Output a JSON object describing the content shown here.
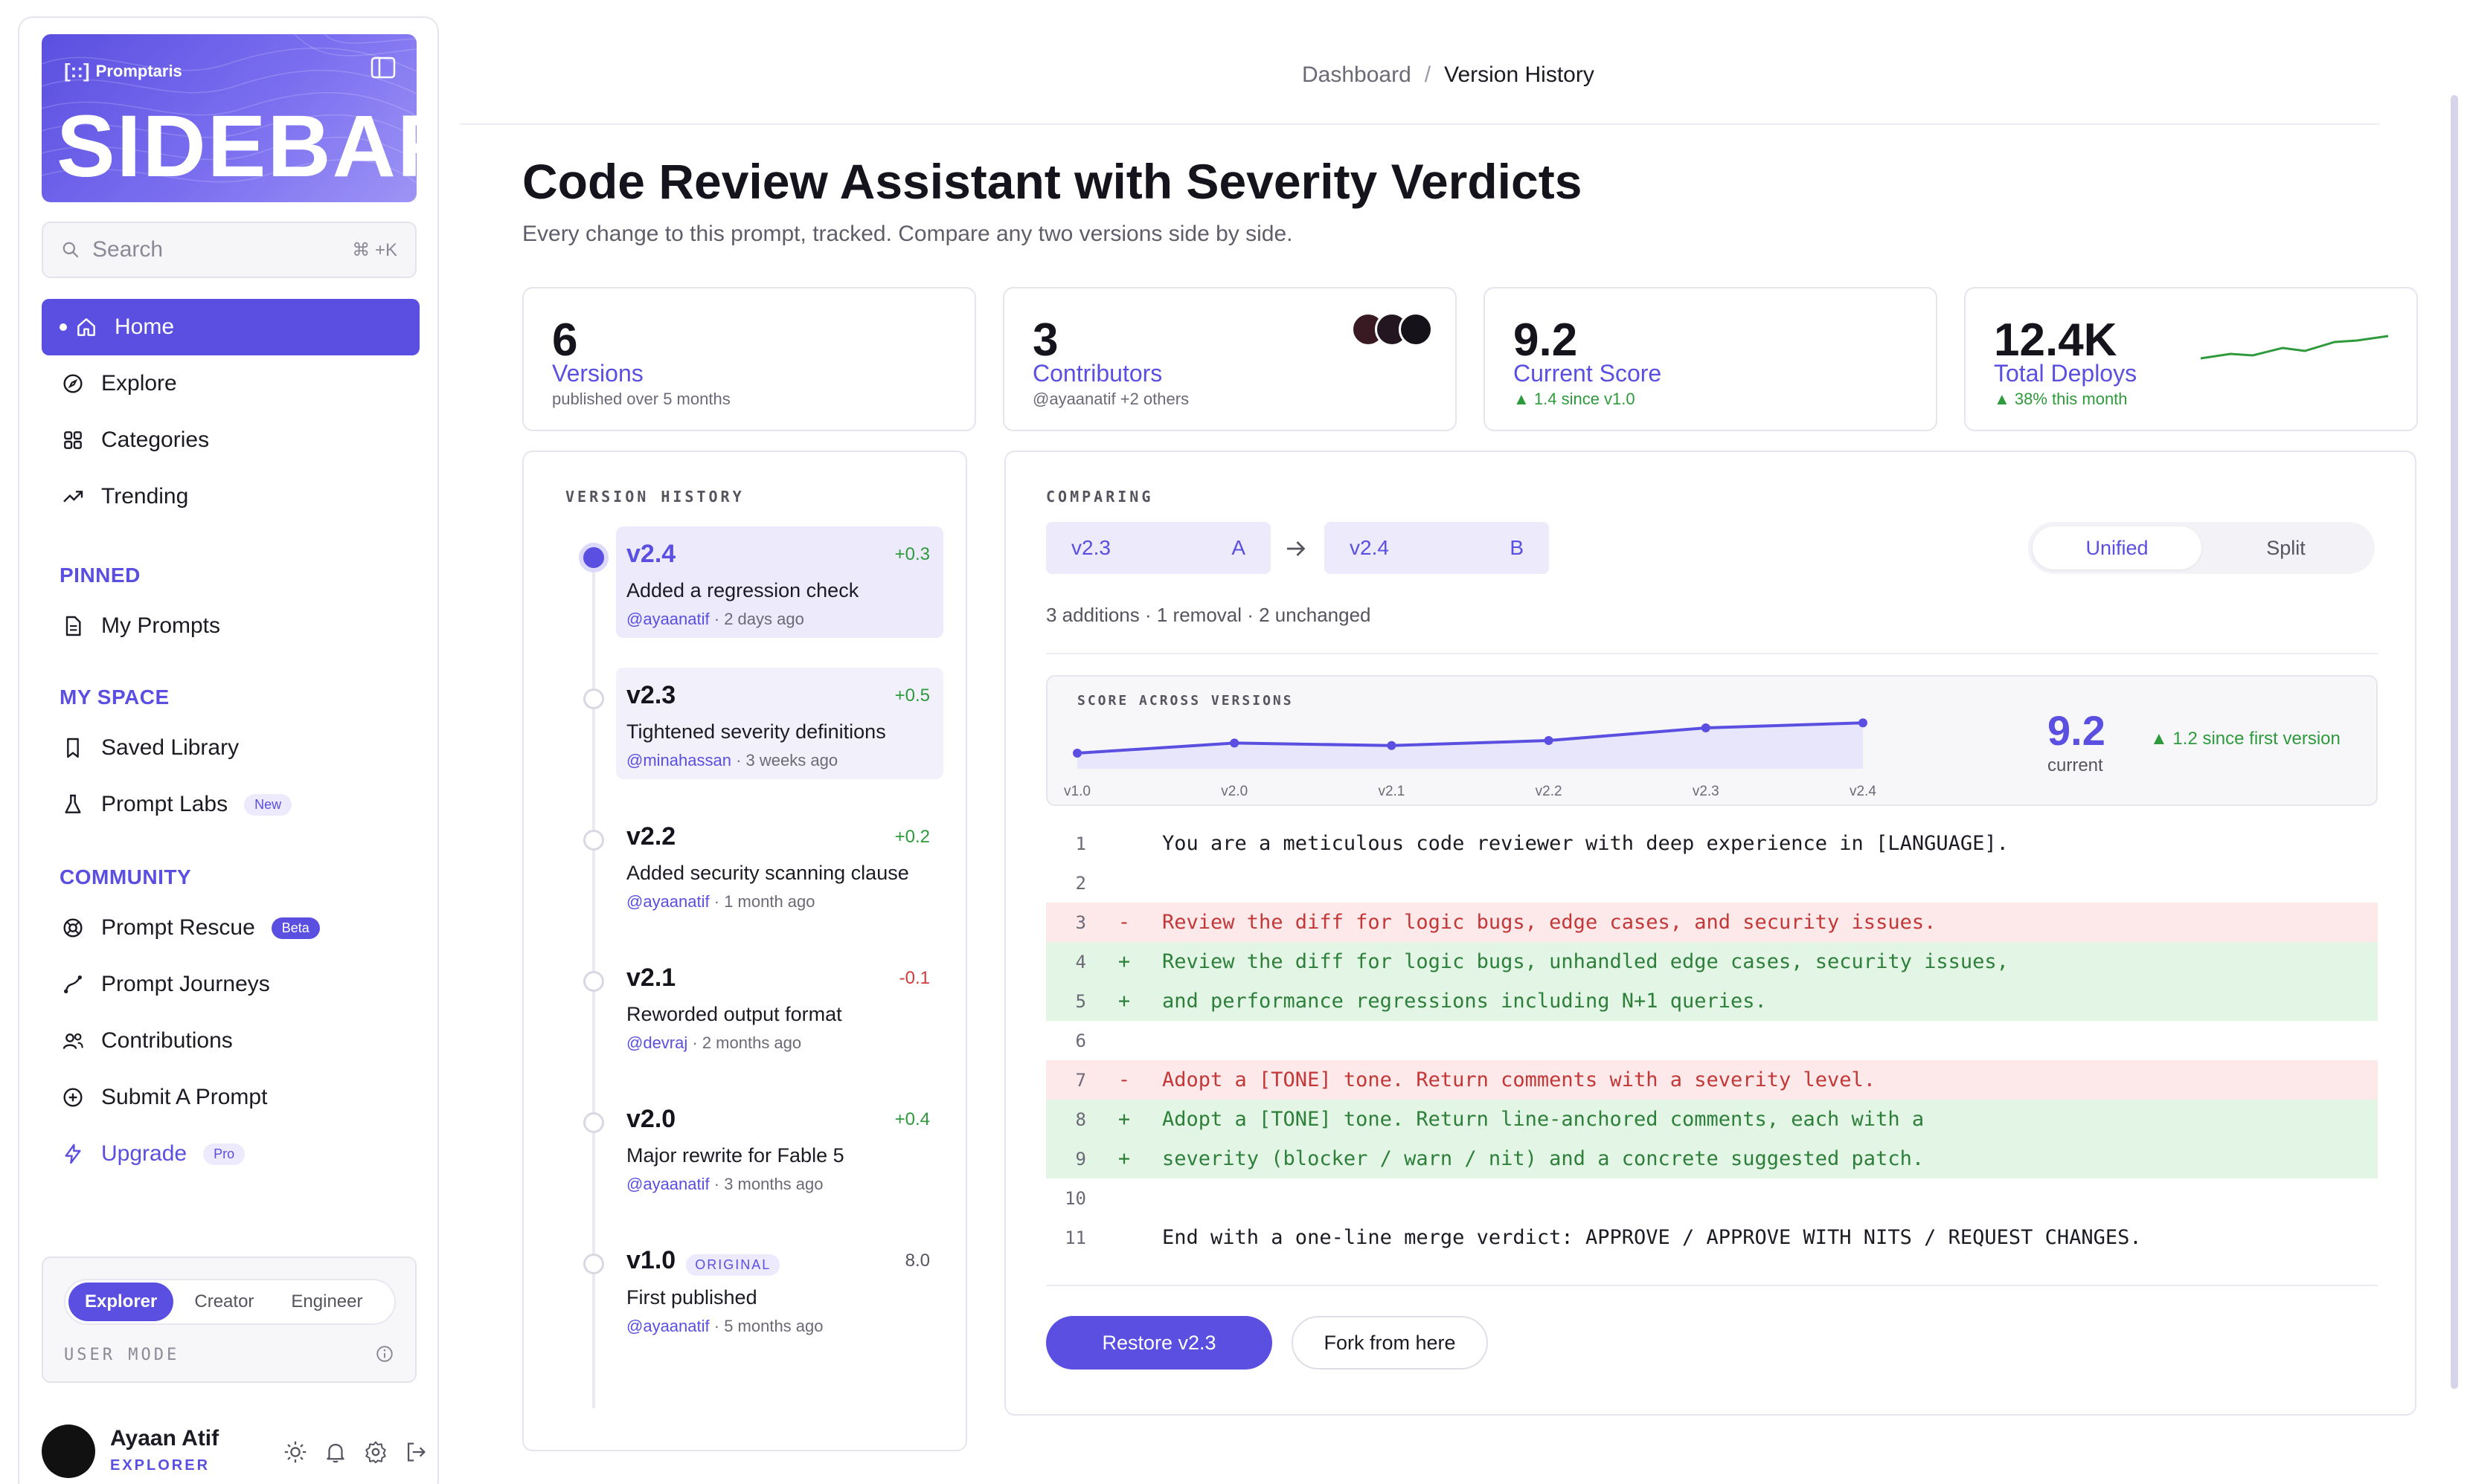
{
  "brand": {
    "name": "Promptaris",
    "wordmark": "SIDEBAR"
  },
  "search": {
    "placeholder": "Search",
    "shortcut": "⌘ +K"
  },
  "nav": {
    "main": [
      {
        "label": "Home",
        "icon": "home-icon",
        "active": true
      },
      {
        "label": "Explore",
        "icon": "compass-icon"
      },
      {
        "label": "Categories",
        "icon": "grid-icon"
      },
      {
        "label": "Trending",
        "icon": "trending-icon"
      }
    ],
    "pinned_title": "PINNED",
    "pinned": [
      {
        "label": "My Prompts",
        "icon": "document-icon"
      }
    ],
    "myspace_title": "MY SPACE",
    "myspace": [
      {
        "label": "Saved Library",
        "icon": "bookmark-icon"
      },
      {
        "label": "Prompt Labs",
        "icon": "flask-icon",
        "badge": "New"
      }
    ],
    "community_title": "COMMUNITY",
    "community": [
      {
        "label": "Prompt Rescue",
        "icon": "lifebuoy-icon",
        "badge": "Beta"
      },
      {
        "label": "Prompt Journeys",
        "icon": "route-icon"
      },
      {
        "label": "Contributions",
        "icon": "users-icon"
      },
      {
        "label": "Submit A Prompt",
        "icon": "plus-circle-icon"
      },
      {
        "label": "Upgrade",
        "icon": "bolt-icon",
        "badge": "Pro"
      }
    ]
  },
  "user_mode": {
    "options": [
      "Explorer",
      "Creator",
      "Engineer"
    ],
    "selected": "Explorer",
    "label": "USER MODE"
  },
  "user": {
    "name": "Ayaan Atif",
    "role": "EXPLORER"
  },
  "breadcrumb": {
    "root": "Dashboard",
    "separator": "/",
    "current": "Version History"
  },
  "page": {
    "title": "Code Review Assistant with Severity Verdicts",
    "subtitle": "Every change to this prompt, tracked. Compare any two versions side by side."
  },
  "stats": [
    {
      "value": "6",
      "label": "Versions",
      "sub": "published over 5 months"
    },
    {
      "value": "3",
      "label": "Contributors",
      "sub": "@ayaanatif +2 others"
    },
    {
      "value": "9.2",
      "label": "Current Score",
      "sub": "▲ 1.4 since v1.0"
    },
    {
      "value": "12.4K",
      "label": "Total Deploys",
      "sub": "▲ 38% this month"
    }
  ],
  "colors": {
    "accent": "#5a4fe0",
    "positive": "#2e9a3c",
    "negative": "#d23b3b"
  },
  "history": {
    "title": "VERSION HISTORY",
    "versions": [
      {
        "version": "v2.4",
        "delta": "+0.3",
        "description": "Added a regression check",
        "author": "@ayaanatif",
        "when": "2 days ago"
      },
      {
        "version": "v2.3",
        "delta": "+0.5",
        "description": "Tightened severity definitions",
        "author": "@minahassan",
        "when": "3 weeks ago"
      },
      {
        "version": "v2.2",
        "delta": "+0.2",
        "description": "Added security scanning clause",
        "author": "@ayaanatif",
        "when": "1 month ago"
      },
      {
        "version": "v2.1",
        "delta": "-0.1",
        "description": "Reworded output format",
        "author": "@devraj",
        "when": "2 months ago"
      },
      {
        "version": "v2.0",
        "delta": "+0.4",
        "description": "Major rewrite for Fable 5",
        "author": "@ayaanatif",
        "when": "3 months ago"
      },
      {
        "version": "v1.0",
        "delta": "8.0",
        "tag": "ORIGINAL",
        "description": "First published",
        "author": "@ayaanatif",
        "when": "5 months ago"
      }
    ]
  },
  "compare": {
    "title": "COMPARING",
    "a": {
      "version": "v2.3",
      "letter": "A"
    },
    "b": {
      "version": "v2.4",
      "letter": "B"
    },
    "views": [
      "Unified",
      "Split"
    ],
    "selected_view": "Unified",
    "summary": "3 additions · 1 removal · 2 unchanged",
    "score": {
      "title": "SCORE ACROSS VERSIONS",
      "current_value": "9.2",
      "current_label": "current",
      "since": "▲ 1.2 since first version"
    },
    "lines": [
      {
        "n": "1",
        "type": "same",
        "text": "You are a meticulous code reviewer with deep experience in [LANGUAGE]."
      },
      {
        "n": "2",
        "type": "same",
        "text": ""
      },
      {
        "n": "3",
        "type": "del",
        "text": "Review the diff for logic bugs, edge cases, and security issues."
      },
      {
        "n": "4",
        "type": "add",
        "text": "Review the diff for logic bugs, unhandled edge cases, security issues,"
      },
      {
        "n": "5",
        "type": "add",
        "text": "and performance regressions including N+1 queries."
      },
      {
        "n": "6",
        "type": "same",
        "text": ""
      },
      {
        "n": "7",
        "type": "del",
        "text": "Adopt a [TONE] tone. Return comments with a severity level."
      },
      {
        "n": "8",
        "type": "add",
        "text": "Adopt a [TONE] tone. Return line-anchored comments, each with a"
      },
      {
        "n": "9",
        "type": "add",
        "text": "severity (blocker / warn / nit) and a concrete suggested patch."
      },
      {
        "n": "10",
        "type": "same",
        "text": ""
      },
      {
        "n": "11",
        "type": "same",
        "text": "End with a one-line merge verdict: APPROVE / APPROVE WITH NITS / REQUEST CHANGES."
      }
    ],
    "markers": {
      "del": "-",
      "add": "+"
    },
    "restore_label": "Restore v2.3",
    "fork_label": "Fork from here"
  },
  "chart_data": {
    "type": "line",
    "title": "SCORE ACROSS VERSIONS",
    "categories": [
      "v1.0",
      "v2.0",
      "v2.1",
      "v2.2",
      "v2.3",
      "v2.4"
    ],
    "values": [
      8.0,
      8.4,
      8.3,
      8.5,
      9.0,
      9.2
    ],
    "ylim": [
      7.5,
      9.5
    ],
    "grid": false,
    "color": "#5a4fe0"
  }
}
